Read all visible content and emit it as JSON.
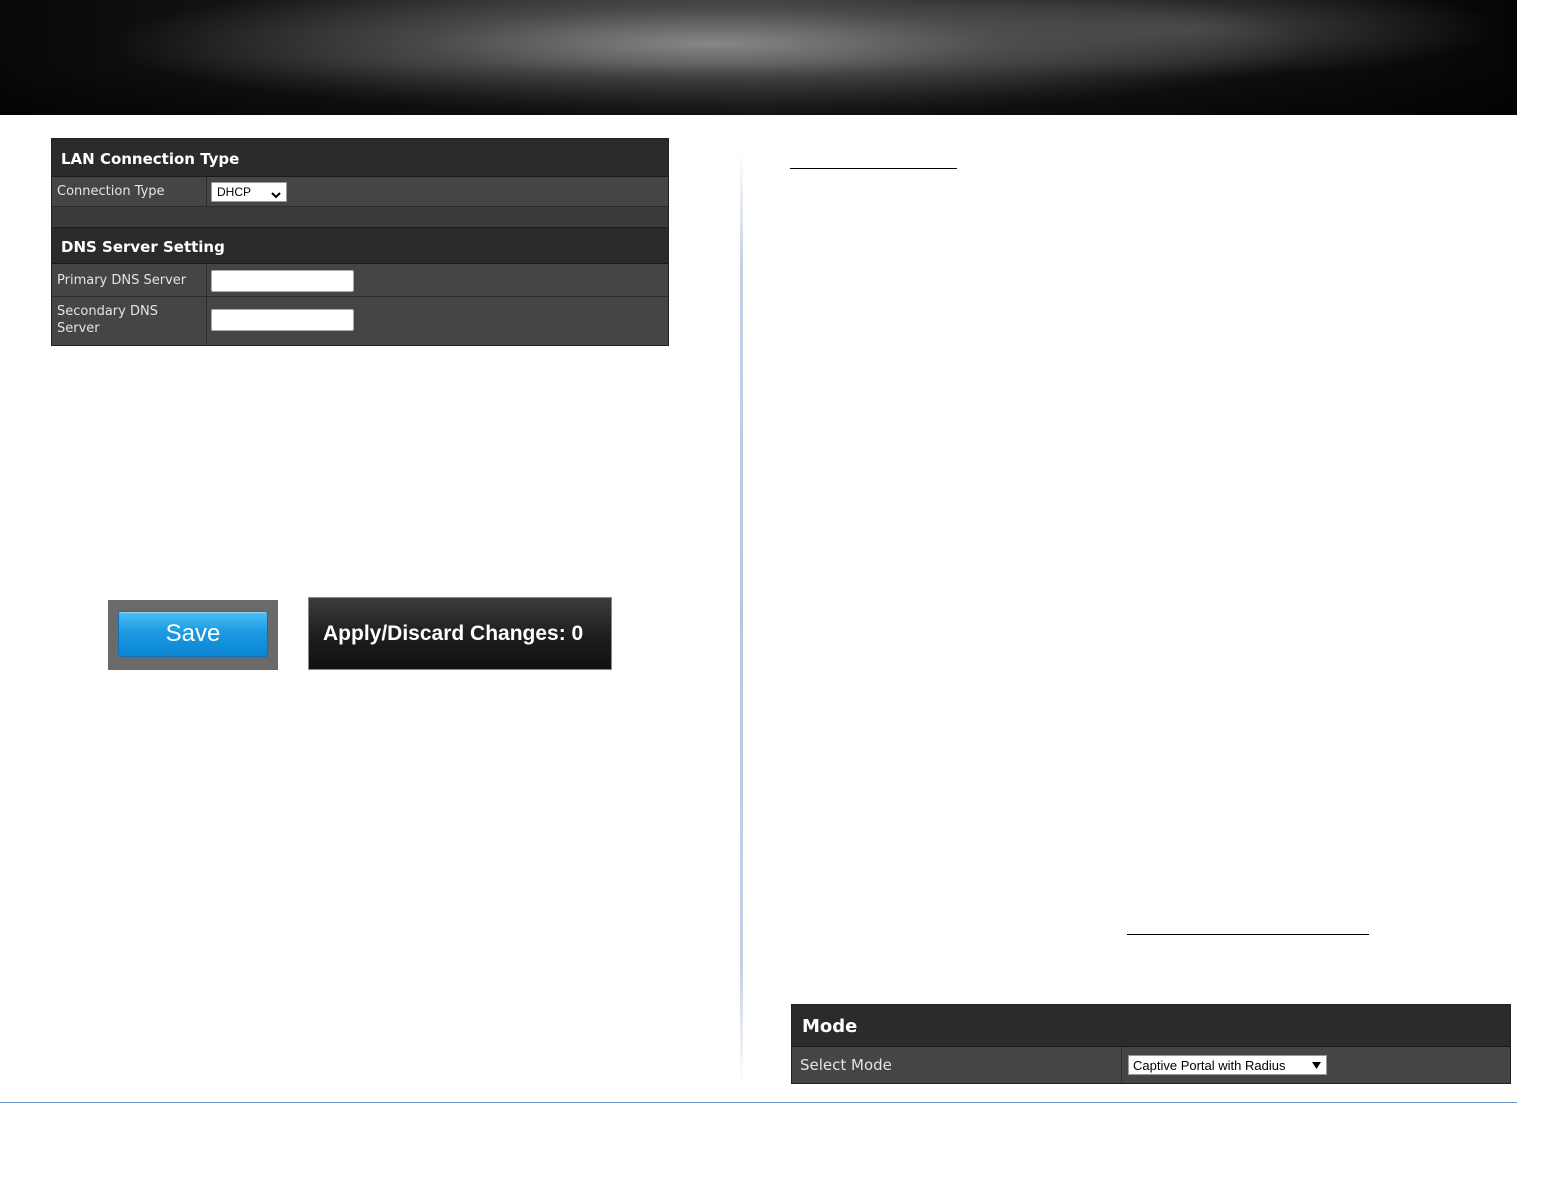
{
  "lan_panel": {
    "lan_title": "LAN Connection Type",
    "connection_type_label": "Connection Type",
    "connection_type_value": "DHCP",
    "dns_title": "DNS Server Setting",
    "primary_dns_label": "Primary DNS Server",
    "primary_dns_value": "",
    "secondary_dns_label_line1": "Secondary DNS",
    "secondary_dns_label_line2": "Server",
    "secondary_dns_value": ""
  },
  "buttons": {
    "save_label": "Save",
    "apply_label": "Apply/Discard Changes: 0"
  },
  "mode_panel": {
    "title": "Mode",
    "select_mode_label": "Select Mode",
    "select_mode_value": "Captive Portal with Radius"
  }
}
